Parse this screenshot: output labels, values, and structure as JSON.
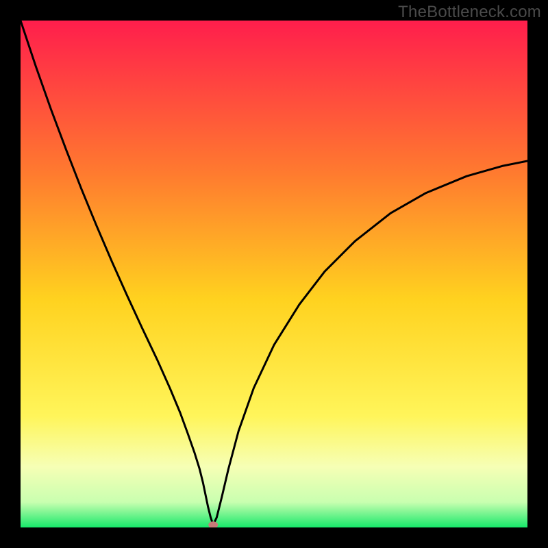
{
  "watermark": "TheBottleneck.com",
  "chart_data": {
    "type": "line",
    "title": "",
    "xlabel": "",
    "ylabel": "",
    "xlim": [
      0,
      100
    ],
    "ylim": [
      0,
      100
    ],
    "gradient_stops": [
      {
        "pct": 0,
        "color": "#ff1e4c"
      },
      {
        "pct": 30,
        "color": "#ff7a2f"
      },
      {
        "pct": 55,
        "color": "#ffd21f"
      },
      {
        "pct": 78,
        "color": "#fff55a"
      },
      {
        "pct": 88,
        "color": "#f6ffb5"
      },
      {
        "pct": 95,
        "color": "#c9ffb0"
      },
      {
        "pct": 100,
        "color": "#17e86a"
      }
    ],
    "series": [
      {
        "name": "bottleneck-curve",
        "x": [
          0,
          3,
          6,
          9,
          12,
          15,
          18,
          21,
          24,
          27,
          29.5,
          31.5,
          33.0,
          34.3,
          35.3,
          36.0,
          36.5,
          37.0,
          37.5,
          38.0,
          38.7,
          39.7,
          41.0,
          43.0,
          46.0,
          50.0,
          55.0,
          60.0,
          66.0,
          73.0,
          80.0,
          88.0,
          95.0,
          100.0
        ],
        "y": [
          100,
          91.0,
          82.5,
          74.5,
          66.8,
          59.5,
          52.5,
          45.8,
          39.3,
          33.0,
          27.4,
          22.6,
          18.5,
          14.8,
          11.6,
          8.8,
          6.4,
          4.0,
          2.0,
          0.5,
          2.0,
          6.0,
          11.5,
          19.0,
          27.5,
          36.0,
          44.0,
          50.5,
          56.5,
          62.0,
          66.0,
          69.3,
          71.3,
          72.3
        ]
      }
    ],
    "marker": {
      "x": 38.0,
      "y": 0.5,
      "color": "#c77a78"
    },
    "annotations": []
  }
}
